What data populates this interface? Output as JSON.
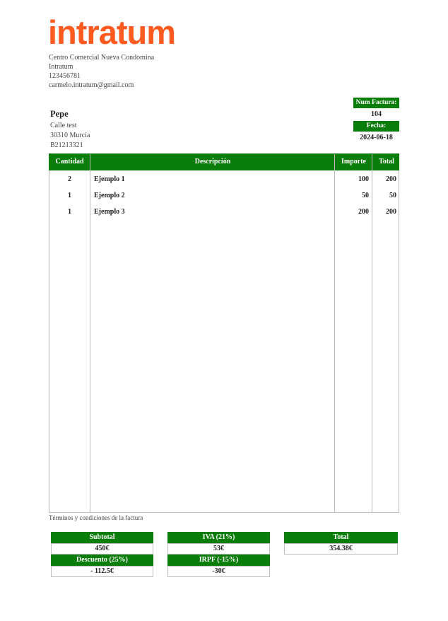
{
  "brand": {
    "logo_text": "intratum",
    "color": "#ff5a1f"
  },
  "company": {
    "lines": [
      "Centro Comercial Nueva Condomina",
      "Intratum",
      "123456781",
      "carmelo.intratum@gmail.com"
    ]
  },
  "client": {
    "name": "Pepe",
    "address": "Calle test",
    "city": "30310 Murcia",
    "tax_id": "B21213321"
  },
  "invoice": {
    "number_label": "Num Factura:",
    "number": "104",
    "date_label": "Fecha:",
    "date": "2024-06-18"
  },
  "table": {
    "headers": [
      "Cantidad",
      "Descripción",
      "Importe",
      "Total"
    ],
    "rows": [
      {
        "qty": "2",
        "desc": "Ejemplo 1",
        "price": "100",
        "total": "200"
      },
      {
        "qty": "1",
        "desc": "Ejemplo 2",
        "price": "50",
        "total": "50"
      },
      {
        "qty": "1",
        "desc": "Ejemplo 3",
        "price": "200",
        "total": "200"
      }
    ]
  },
  "terms": "Términos y condiciones de la factura",
  "totals": {
    "subtotal_label": "Subtotal",
    "subtotal": "450€",
    "iva_label": "IVA (21%)",
    "iva": "53€",
    "total_label": "Total",
    "total": "354.38€",
    "discount_label": "Descuento (25%)",
    "discount": "- 112.5€",
    "irpf_label": "IRPF (-15%)",
    "irpf": "-30€"
  },
  "colors": {
    "accent": "#0a7d0a",
    "border": "#bbbbbb"
  }
}
